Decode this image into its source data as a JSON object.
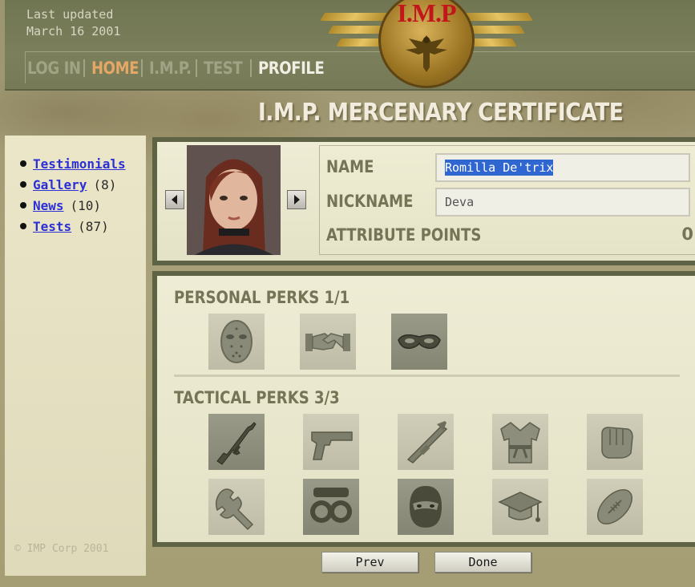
{
  "header": {
    "updated_line1": "Last updated",
    "updated_line2": "March 16 2001",
    "emblem_text": "I.M.P",
    "nav": [
      {
        "label": "LOG IN"
      },
      {
        "label": "HOME"
      },
      {
        "label": "I.M.P."
      },
      {
        "label": "TEST"
      },
      {
        "label": "PROFILE"
      }
    ]
  },
  "page_title": "I.M.P. MERCENARY CERTIFICATE",
  "sidebar": {
    "items": [
      {
        "label": "Testimonials",
        "count": ""
      },
      {
        "label": "Gallery",
        "count": "(8)"
      },
      {
        "label": "News",
        "count": "(10)"
      },
      {
        "label": "Tests",
        "count": "(87)"
      }
    ],
    "copyright": "© IMP Corp 2001"
  },
  "profile": {
    "name_label": "NAME",
    "name_value": "Romilla De'trix",
    "nickname_label": "NICKNAME",
    "nickname_value": "Deva",
    "attr_label": "ATTRIBUTE POINTS",
    "attr_value": "0"
  },
  "perks": {
    "personal_title": "PERSONAL PERKS 1/1",
    "tactical_title": "TACTICAL PERKS 3/3",
    "personal": [
      {
        "icon": "hockey-mask-icon",
        "selected": false
      },
      {
        "icon": "handshake-icon",
        "selected": false
      },
      {
        "icon": "eye-mask-icon",
        "selected": true
      }
    ],
    "tactical": [
      {
        "icon": "assault-rifle-icon",
        "selected": true
      },
      {
        "icon": "pistol-icon",
        "selected": false
      },
      {
        "icon": "rocket-launcher-icon",
        "selected": false
      },
      {
        "icon": "martial-arts-gi-icon",
        "selected": false
      },
      {
        "icon": "fist-icon",
        "selected": false
      },
      {
        "icon": "wrench-icon",
        "selected": false
      },
      {
        "icon": "night-vision-goggles-icon",
        "selected": true
      },
      {
        "icon": "balaclava-icon",
        "selected": true
      },
      {
        "icon": "graduation-cap-icon",
        "selected": false
      },
      {
        "icon": "football-icon",
        "selected": false
      }
    ]
  },
  "buttons": {
    "prev_label": "Prev",
    "done_label": "Done"
  },
  "colors": {
    "nav_active": "#e3a766",
    "selection": "#2f66cf",
    "link": "#2b2fd6"
  }
}
